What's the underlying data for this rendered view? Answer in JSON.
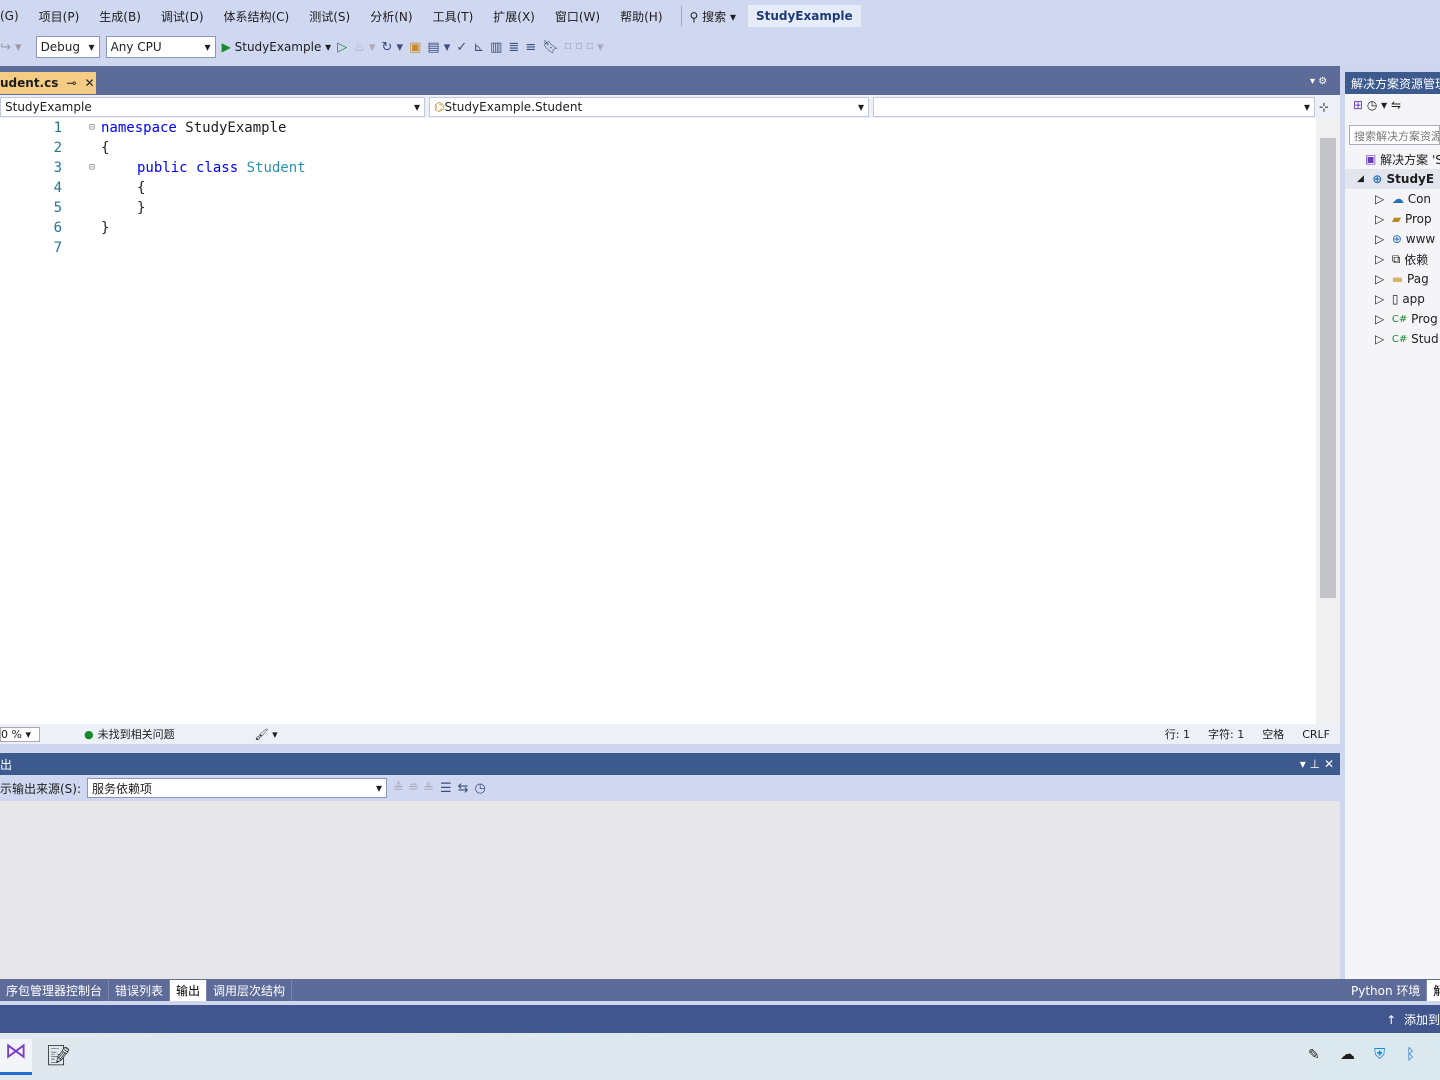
{
  "menu": [
    "(G)",
    "项目(P)",
    "生成(B)",
    "调试(D)",
    "体系结构(C)",
    "测试(S)",
    "分析(N)",
    "工具(T)",
    "扩展(X)",
    "窗口(W)",
    "帮助(H)"
  ],
  "search_label": "搜索",
  "solution_title": "StudyExample",
  "toolbar": {
    "config": "Debug",
    "platform": "Any CPU",
    "run_target": "StudyExample"
  },
  "doc_tab": {
    "name": "udent.cs"
  },
  "nav": {
    "project": "StudyExample",
    "type": "StudyExample.Student",
    "member": ""
  },
  "code": {
    "lines": [
      "1",
      "2",
      "3",
      "4",
      "5",
      "6",
      "7"
    ],
    "l1_kw": "namespace",
    "l1_name": " StudyExample",
    "l2": "{",
    "l3_kw": "public class",
    "l3_name": "Student",
    "l4": "{",
    "l5": "}",
    "l6": "}"
  },
  "editor_status": {
    "zoom": "0 %",
    "issues": "未找到相关问题",
    "line": "行: 1",
    "char": "字符: 1",
    "spaces": "空格",
    "eol": "CRLF"
  },
  "output": {
    "title": "出",
    "source_label": "示输出来源(S):",
    "source_value": "服务依赖项"
  },
  "bottom_tabs": [
    "序包管理器控制台",
    "错误列表",
    "输出",
    "调用层次结构"
  ],
  "solution_explorer": {
    "title": "解决方案资源管理",
    "search_placeholder": "搜索解决方案资源",
    "solution": "解决方案 'S",
    "project": "StudyE",
    "items": [
      "Con",
      "Prop",
      "www",
      "依赖",
      "Pag",
      "app",
      "Prog",
      "Stud"
    ],
    "item_icons": [
      "connected-service-icon",
      "properties-icon",
      "globe-icon",
      "dependencies-icon",
      "folder-icon",
      "json-file-icon",
      "csharp-file-icon",
      "csharp-file-icon"
    ]
  },
  "right_tabs": [
    "Python 环境",
    "解"
  ],
  "status": {
    "add_source": "添加到"
  }
}
